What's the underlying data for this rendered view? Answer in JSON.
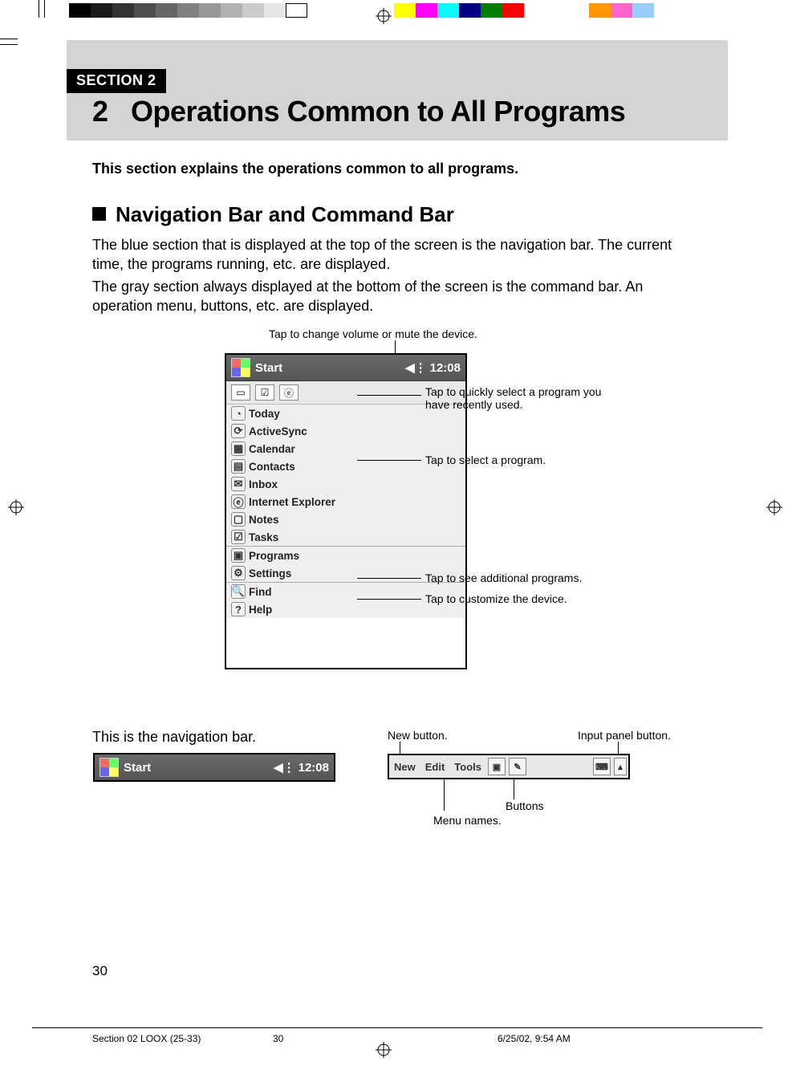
{
  "print": {
    "swatches": [
      "#000000",
      "#1a1a1a",
      "#333333",
      "#4d4d4d",
      "#666666",
      "#808080",
      "#999999",
      "#b3b3b3",
      "#cccccc",
      "#e6e6e6",
      "#ffffff",
      "",
      "",
      "",
      "",
      "#ffff00",
      "#ff00ff",
      "#00ffff",
      "#000080",
      "#008000",
      "#ff0000",
      "",
      "",
      "",
      "#ff9900",
      "#ff66cc",
      "#99ccff"
    ]
  },
  "section_tab": "SECTION 2",
  "chapter_no": "2",
  "chapter_title": "Operations Common to All Programs",
  "intro": "This section explains the operations common to all programs.",
  "h2": "Navigation Bar and Command Bar",
  "p1": "The blue section that is displayed at the top of the screen is the navigation bar. The current time, the programs running, etc. are displayed.",
  "p2": "The gray section always displayed at the bottom of the screen is the command bar. An operation menu, buttons, etc. are displayed.",
  "captions": {
    "volume": "Tap to change volume or mute the device.",
    "recent": "Tap to quickly select a program you have recently used.",
    "select": "Tap to select a program.",
    "additional": "Tap to see additional programs.",
    "customize": "Tap to customize the device."
  },
  "navbar": {
    "start": "Start",
    "time": "12:08"
  },
  "menu": {
    "section1": [
      "Today",
      "ActiveSync",
      "Calendar",
      "Contacts",
      "Inbox",
      "Internet Explorer",
      "Notes",
      "Tasks"
    ],
    "section2": [
      "Programs",
      "Settings"
    ],
    "section3": [
      "Find",
      "Help"
    ]
  },
  "nav_caption": "This is the navigation bar.",
  "cmdbar": {
    "new": "New",
    "edit": "Edit",
    "tools": "Tools",
    "labels": {
      "new_btn": "New button.",
      "input_btn": "Input panel button.",
      "buttons": "Buttons",
      "menu_names": "Menu names."
    }
  },
  "page_number": "30",
  "footer": {
    "doc": "Section 02 LOOX (25-33)",
    "page": "30",
    "timestamp": "6/25/02, 9:54 AM"
  }
}
